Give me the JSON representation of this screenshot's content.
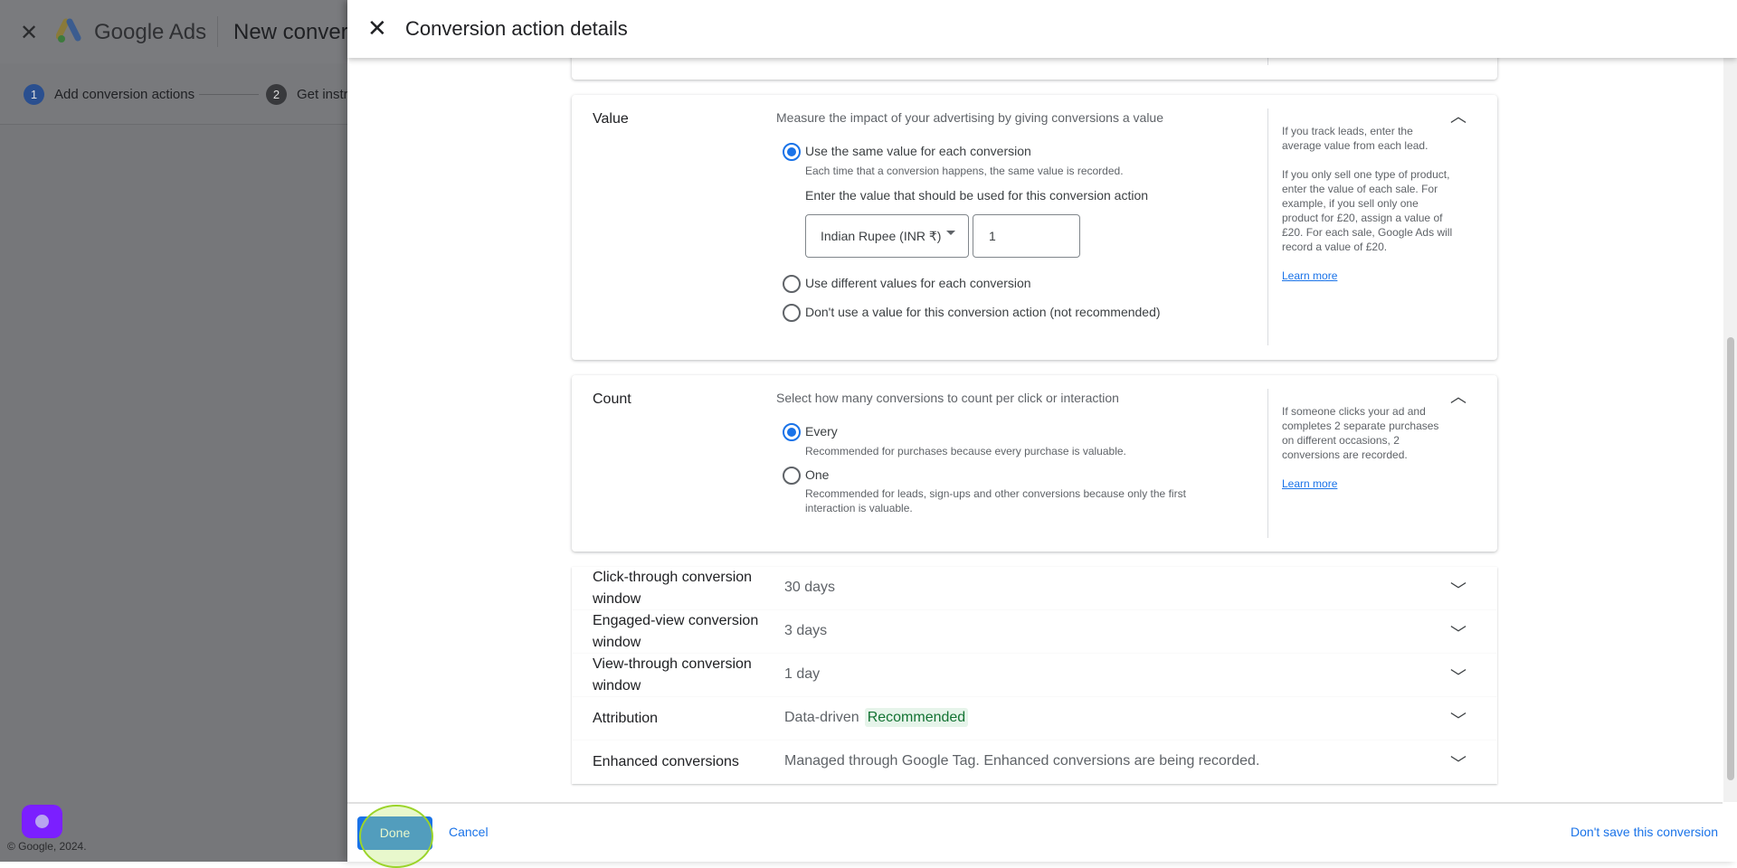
{
  "background": {
    "brand": "Google Ads",
    "page_title": "New convers",
    "steps": [
      {
        "num": "1",
        "label": "Add conversion actions"
      },
      {
        "num": "2",
        "label": "Get instr"
      }
    ],
    "copyright": "© Google, 2024."
  },
  "panel": {
    "title": "Conversion action details",
    "value": {
      "label": "Value",
      "description": "Measure the impact of your advertising by giving conversions a value",
      "options": [
        {
          "label": "Use the same value for each conversion",
          "sub": "Each time that a conversion happens, the same value is recorded.",
          "selected": true
        },
        {
          "label": "Use different values for each conversion",
          "selected": false
        },
        {
          "label": "Don't use a value for this conversion action (not recommended)",
          "selected": false
        }
      ],
      "enter_prompt": "Enter the value that should be used for this conversion action",
      "currency": "Indian Rupee (INR ₹)",
      "amount": "1",
      "help": [
        "If you track leads, enter the average value from each lead.",
        "If you only sell one type of product, enter the value of each sale. For example, if you sell only one product for £20, assign a value of £20. For each sale, Google Ads will record a value of £20."
      ],
      "learn_more": "Learn more"
    },
    "count": {
      "label": "Count",
      "description": "Select how many conversions to count per click or interaction",
      "options": [
        {
          "label": "Every",
          "sub": "Recommended for purchases because every purchase is valuable.",
          "selected": true
        },
        {
          "label": "One",
          "sub": "Recommended for leads, sign-ups and other conversions because only the first interaction is valuable.",
          "selected": false
        }
      ],
      "help": "If someone clicks your ad and completes 2 separate purchases on different occasions, 2 conversions are recorded.",
      "learn_more": "Learn more"
    },
    "rows": [
      {
        "label": "Click-through conversion window",
        "value": "30 days"
      },
      {
        "label": "Engaged-view conversion window",
        "value": "3 days"
      },
      {
        "label": "View-through conversion window",
        "value": "1 day"
      },
      {
        "label": "Attribution",
        "value": "Data-driven",
        "badge": "Recommended"
      },
      {
        "label": "Enhanced conversions",
        "value": "Managed through Google Tag. Enhanced conversions are being recorded."
      }
    ],
    "footer": {
      "done": "Done",
      "cancel": "Cancel",
      "dont_save": "Don't save this conversion"
    }
  }
}
